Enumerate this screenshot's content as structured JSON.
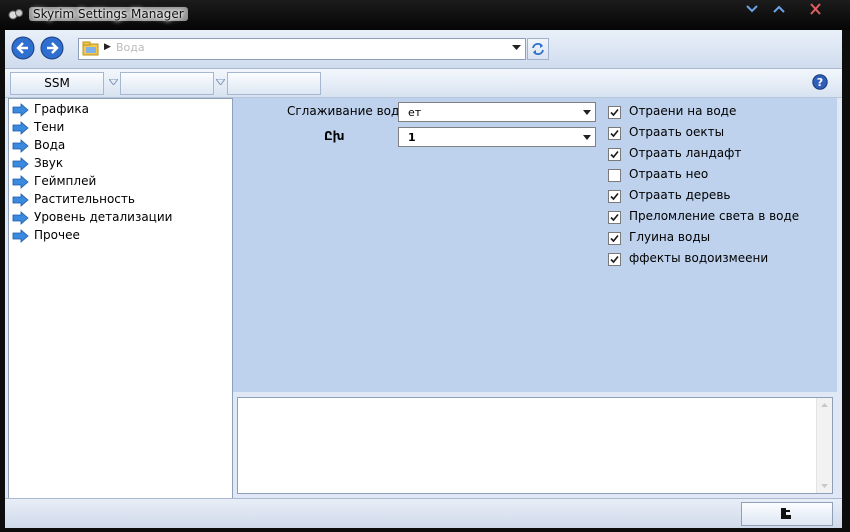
{
  "window": {
    "title": "Skyrim Settings Manager",
    "title_glow_color": "#ffffff"
  },
  "address_bar": {
    "path_label": "Вода"
  },
  "toolbar": {
    "ssm_label": "SSM",
    "dropdown1_label": "",
    "dropdown2_label": ""
  },
  "sidebar": {
    "items": [
      {
        "label": "Графика"
      },
      {
        "label": "Тени"
      },
      {
        "label": "Вода"
      },
      {
        "label": "Звук"
      },
      {
        "label": "Геймплей"
      },
      {
        "label": "Растительность"
      },
      {
        "label": "Уровень детализации"
      },
      {
        "label": "Прочее"
      }
    ]
  },
  "settings": {
    "antialias_label": "Сглаживание воды",
    "antialias_value": "ет",
    "second_label": "Ըխ",
    "second_value": "1"
  },
  "checkboxes": [
    {
      "label": "Отраени на воде",
      "checked": true
    },
    {
      "label": "Отраать оекты",
      "checked": true
    },
    {
      "label": "Отраать ландафт",
      "checked": true
    },
    {
      "label": "Отраать нео",
      "checked": false
    },
    {
      "label": "Отраать деревь",
      "checked": true
    },
    {
      "label": "Преломление света в воде",
      "checked": true
    },
    {
      "label": "Глуина воды",
      "checked": true
    },
    {
      "label": "ффекты водоизмеени",
      "checked": true
    }
  ],
  "colors": {
    "accent": "#2f6fcf",
    "panel_bg": "#bed2ee",
    "frame": "#0d0d0d"
  }
}
